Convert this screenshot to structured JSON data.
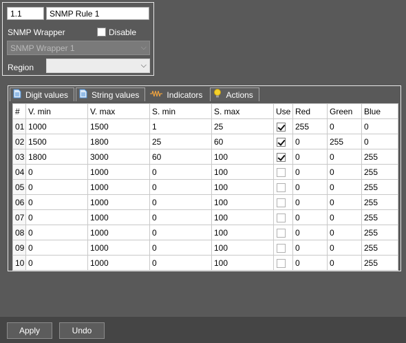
{
  "rule": {
    "id": "1.1",
    "name": "SNMP Rule 1"
  },
  "wrapper": {
    "label": "SNMP Wrapper",
    "disable_label": "Disable",
    "disable_checked": false,
    "selected": "SNMP Wrapper 1"
  },
  "region": {
    "label": "Region",
    "selected": ""
  },
  "tabs": [
    {
      "label": "Digit values",
      "icon": "document-icon",
      "active": false
    },
    {
      "label": "String values",
      "icon": "document-icon",
      "active": false
    },
    {
      "label": "Indicators",
      "icon": "waveform-icon",
      "active": true
    },
    {
      "label": "Actions",
      "icon": "lightbulb-icon",
      "active": false
    }
  ],
  "table": {
    "columns": [
      "#",
      "V. min",
      "V. max",
      "S. min",
      "S. max",
      "Use",
      "Red",
      "Green",
      "Blue"
    ],
    "rows": [
      {
        "num": "01",
        "vmin": "1000",
        "vmax": "1500",
        "smin": "1",
        "smax": "25",
        "use": true,
        "red": "255",
        "green": "0",
        "blue": "0"
      },
      {
        "num": "02",
        "vmin": "1500",
        "vmax": "1800",
        "smin": "25",
        "smax": "60",
        "use": true,
        "red": "0",
        "green": "255",
        "blue": "0"
      },
      {
        "num": "03",
        "vmin": "1800",
        "vmax": "3000",
        "smin": "60",
        "smax": "100",
        "use": true,
        "red": "0",
        "green": "0",
        "blue": "255"
      },
      {
        "num": "04",
        "vmin": "0",
        "vmax": "1000",
        "smin": "0",
        "smax": "100",
        "use": false,
        "red": "0",
        "green": "0",
        "blue": "255"
      },
      {
        "num": "05",
        "vmin": "0",
        "vmax": "1000",
        "smin": "0",
        "smax": "100",
        "use": false,
        "red": "0",
        "green": "0",
        "blue": "255"
      },
      {
        "num": "06",
        "vmin": "0",
        "vmax": "1000",
        "smin": "0",
        "smax": "100",
        "use": false,
        "red": "0",
        "green": "0",
        "blue": "255"
      },
      {
        "num": "07",
        "vmin": "0",
        "vmax": "1000",
        "smin": "0",
        "smax": "100",
        "use": false,
        "red": "0",
        "green": "0",
        "blue": "255"
      },
      {
        "num": "08",
        "vmin": "0",
        "vmax": "1000",
        "smin": "0",
        "smax": "100",
        "use": false,
        "red": "0",
        "green": "0",
        "blue": "255"
      },
      {
        "num": "09",
        "vmin": "0",
        "vmax": "1000",
        "smin": "0",
        "smax": "100",
        "use": false,
        "red": "0",
        "green": "0",
        "blue": "255"
      },
      {
        "num": "10",
        "vmin": "0",
        "vmax": "1000",
        "smin": "0",
        "smax": "100",
        "use": false,
        "red": "0",
        "green": "0",
        "blue": "255"
      }
    ]
  },
  "buttons": {
    "apply": "Apply",
    "undo": "Undo"
  },
  "colors": {
    "background": "#595959",
    "bottom_bar": "#454545",
    "indicator_icon": "#e8a040",
    "lightbulb": "#f5d22a",
    "document_icon": "#4a90d9"
  }
}
